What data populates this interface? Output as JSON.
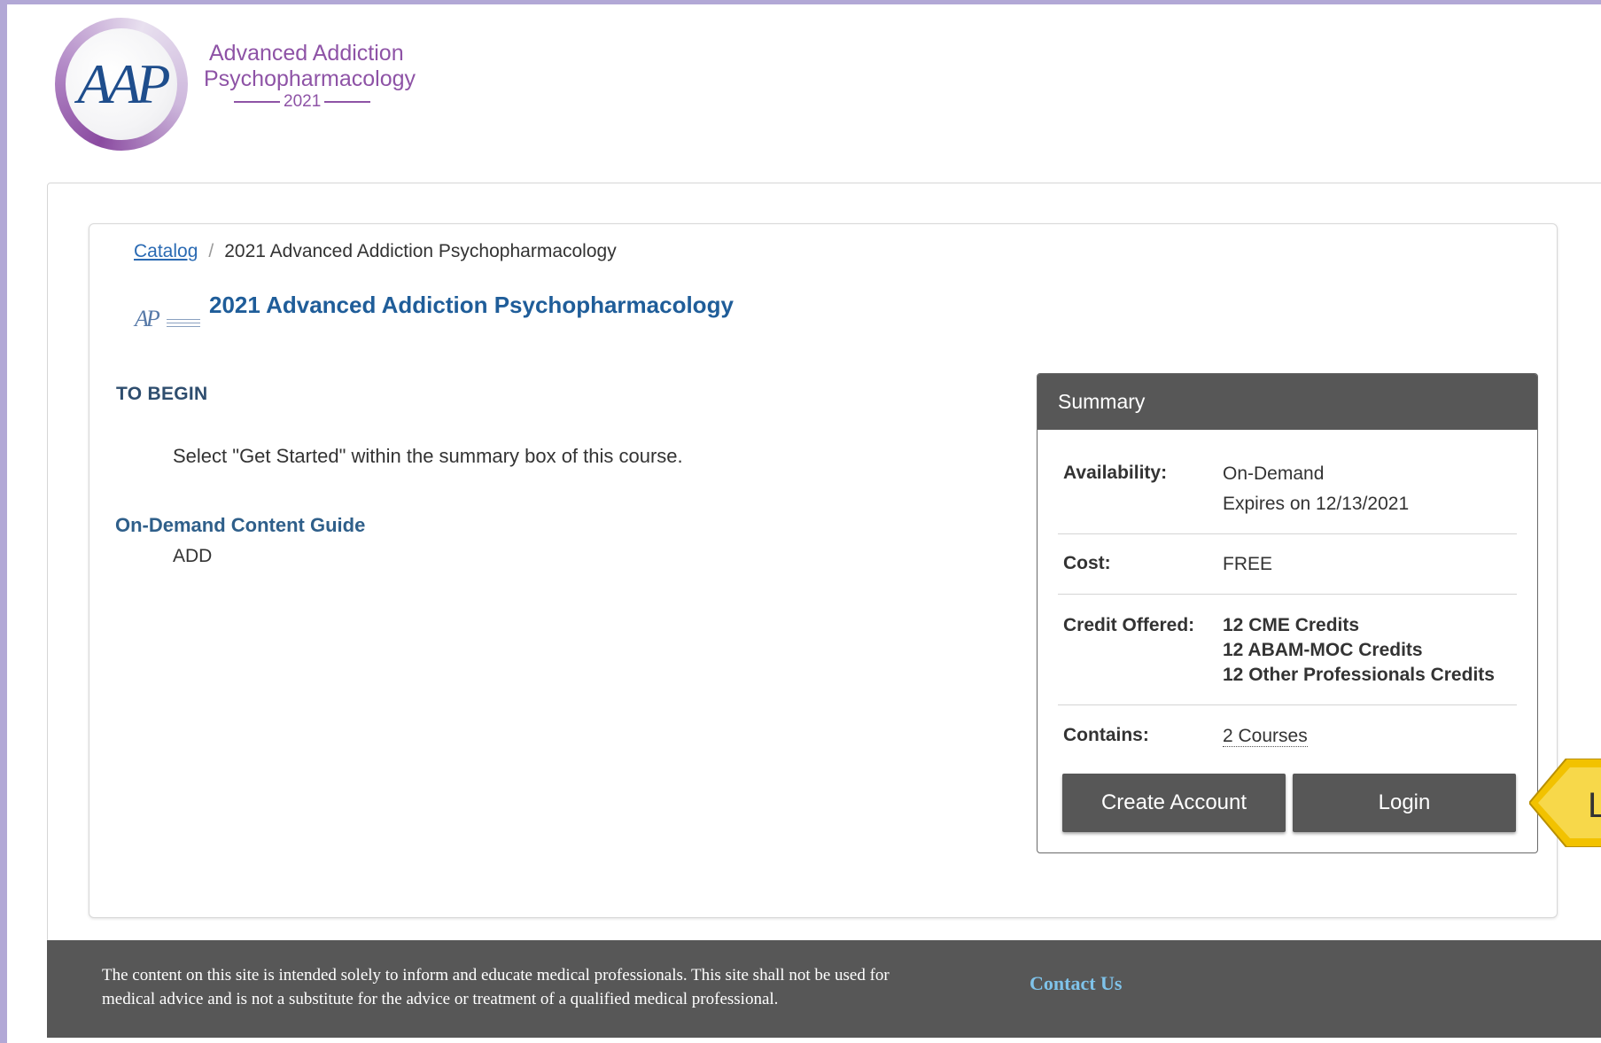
{
  "header": {
    "logo": {
      "mark": "AAP",
      "line1": "Advanced Addiction",
      "line2": "Psychopharmacology",
      "year": "2021"
    }
  },
  "breadcrumb": {
    "root_label": "Catalog",
    "current": "2021 Advanced Addiction Psychopharmacology",
    "separator": "/"
  },
  "course": {
    "thumb_mark": "AP",
    "title": "2021 Advanced Addiction Psychopharmacology"
  },
  "content": {
    "to_begin_heading": "TO BEGIN",
    "instruction": "Select \"Get Started\" within the summary box of this course.",
    "guide_heading": "On-Demand Content Guide",
    "guide_text": "ADD"
  },
  "summary": {
    "heading": "Summary",
    "availability_label": "Availability:",
    "availability_value": "On-Demand",
    "expires": "Expires on 12/13/2021",
    "cost_label": "Cost:",
    "cost_value": "FREE",
    "credit_label": "Credit Offered:",
    "credits": [
      {
        "count": "12",
        "name": "CME Credits"
      },
      {
        "count": "12",
        "name": "ABAM-MOC Credits"
      },
      {
        "count": "12",
        "name": "Other Professionals Credits"
      }
    ],
    "contains_label": "Contains:",
    "contains_value": "2 Courses",
    "create_account_label": "Create Account",
    "login_label": "Login"
  },
  "callout": {
    "letter": "L",
    "color": "#f2c200"
  },
  "footer": {
    "disclaimer_line1": "The content on this site is intended solely to inform and educate medical professionals. This site shall not be used for",
    "disclaimer_line2": "medical advice and is not a substitute for the advice or treatment of a qualified medical professional.",
    "contact_label": "Contact Us"
  },
  "colors": {
    "frame": "#b2a8d6",
    "accent_blue": "#1f5d99",
    "dark_gray": "#575757",
    "logo_purple": "#8e53a6",
    "footer_link": "#7fc3ea"
  }
}
